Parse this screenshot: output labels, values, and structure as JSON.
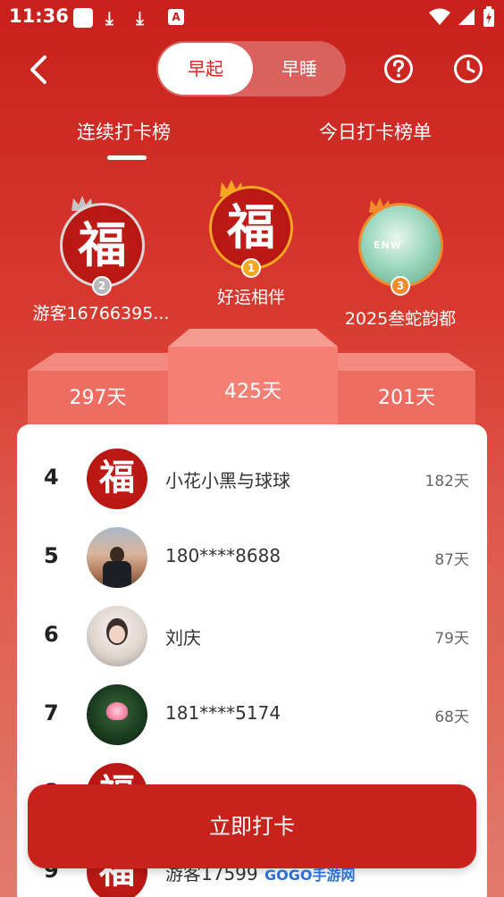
{
  "status_bar": {
    "time": "11:36"
  },
  "header": {
    "segment": {
      "active": "早起",
      "inactive": "早睡"
    }
  },
  "tabs": [
    {
      "label": "连续打卡榜",
      "active": true
    },
    {
      "label": "今日打卡榜单",
      "active": false
    }
  ],
  "podium": [
    {
      "rank": "2",
      "name": "游客16766395...",
      "days": "297天",
      "avatar": "fu",
      "crown": "silver"
    },
    {
      "rank": "1",
      "name": "好运相伴",
      "days": "425天",
      "avatar": "fu",
      "crown": "gold"
    },
    {
      "rank": "3",
      "name": "2025叁蛇韵都",
      "days": "201天",
      "avatar": "product-photo",
      "avatar_text": "ENW",
      "crown": "orange"
    }
  ],
  "avatar_glyph": "福",
  "list": [
    {
      "rank": "4",
      "name": "小花小黑与球球",
      "days": "182天",
      "avatar": "fu"
    },
    {
      "rank": "5",
      "name": "180****8688",
      "days": "87天",
      "avatar": "photo-man"
    },
    {
      "rank": "6",
      "name": "刘庆",
      "days": "79天",
      "avatar": "photo-woman"
    },
    {
      "rank": "7",
      "name": "181****5174",
      "days": "68天",
      "avatar": "photo-lotus"
    },
    {
      "rank": "8",
      "name": "",
      "days": "",
      "avatar": "fu"
    },
    {
      "rank": "9",
      "name": "游客17599",
      "days": "",
      "avatar": "fu"
    }
  ],
  "cta": {
    "label": "立即打卡"
  },
  "watermark": {
    "text": "GOGO手游网"
  },
  "colors": {
    "primary": "#c8201c",
    "gold": "#f5a623",
    "silver": "#b8b8b8",
    "bronze": "#f08a2c"
  }
}
